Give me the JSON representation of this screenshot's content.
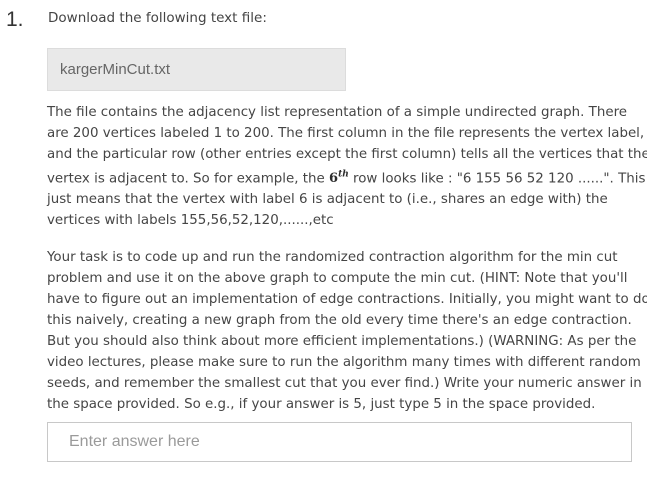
{
  "question": {
    "number": "1.",
    "prompt": "Download the following text file:",
    "file_name": "kargerMinCut.txt"
  },
  "paragraph1": {
    "line1": "The file contains the adjacency list representation of a simple undirected graph. There",
    "line2": "are 200 vertices labeled 1 to 200. The first column in the file represents the vertex label,",
    "line3": "and the particular row (other entries except the first column) tells all the vertices that the",
    "line4_pre": "vertex is adjacent to. So for example, the ",
    "line4_num": "6",
    "line4_sup": "th",
    "line4_post": " row looks like : \"6 155 56 52 120 ......\". This",
    "line5": "just means that the vertex with label 6 is adjacent to (i.e., shares an edge with) the",
    "line6": "vertices with labels 155,56,52,120,......,etc"
  },
  "paragraph2": {
    "lines": [
      "Your task is to code up and run the randomized contraction algorithm for the min cut",
      "problem and use it on the above graph to compute the min cut. (HINT: Note that you'll",
      "have to figure out an implementation of edge contractions. Initially, you might want to do",
      "this naively, creating a new graph from the old every time there's an edge contraction.",
      "But you should also think about more efficient implementations.) (WARNING: As per the",
      "video lectures, please make sure to run the algorithm many times with different random",
      "seeds, and remember the smallest cut that you ever find.) Write your numeric answer in",
      "the space provided. So e.g., if your answer is 5, just type 5 in the space provided."
    ]
  },
  "answer": {
    "value": "",
    "placeholder": "Enter answer here"
  }
}
